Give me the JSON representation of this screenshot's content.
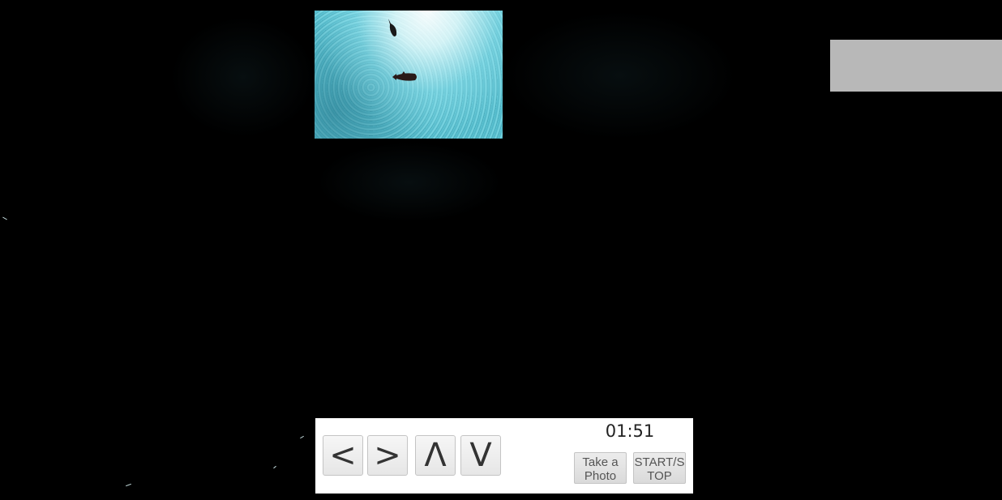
{
  "controls": {
    "left_label": "<",
    "right_label": ">",
    "up_label": "Λ",
    "down_label": "V",
    "photo_label": "Take a\nPhoto",
    "startstop_label": "START/S\nTOP"
  },
  "timer": {
    "value": "01:51"
  },
  "colors": {
    "background": "#000000",
    "water": "#52bccd",
    "panel": "#ffffff",
    "gray_panel": "#b8b8b8"
  }
}
